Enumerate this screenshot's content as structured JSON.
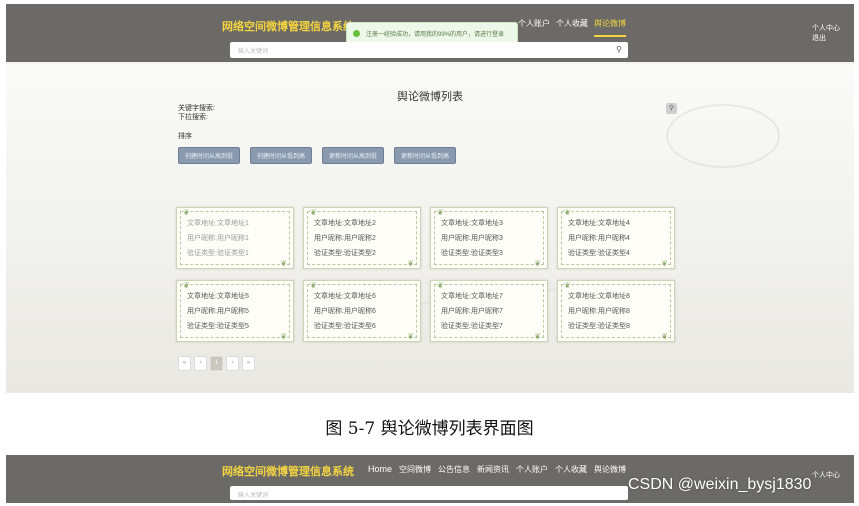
{
  "top_shot": {
    "brand": "网络空间微博管理信息系统",
    "toast": "注册一经验成功，请用我的99%的用户，请进行登录",
    "nav": [
      "个人账户",
      "个人收藏",
      "舆论微博"
    ],
    "user_menu": {
      "center": "个人中心",
      "logout": "退出"
    },
    "search_placeholder": "输入关键词",
    "page_title": "舆论微博列表",
    "filters": {
      "keyword_label": "关键字搜索:",
      "dropdown_label": "下拉搜索:"
    },
    "sort_label": "排序",
    "sort_buttons": [
      "创建时间从高到低",
      "创建时间从低到高",
      "更新时间从高到低",
      "更新时间从低到高"
    ],
    "cards": [
      {
        "a": "文章地址:文章地址1",
        "b": "用户昵称:用户昵称1",
        "c": "验证类型:验证类型1"
      },
      {
        "a": "文章地址:文章地址2",
        "b": "用户昵称:用户昵称2",
        "c": "验证类型:验证类型2"
      },
      {
        "a": "文章地址:文章地址3",
        "b": "用户昵称:用户昵称3",
        "c": "验证类型:验证类型3"
      },
      {
        "a": "文章地址:文章地址4",
        "b": "用户昵称:用户昵称4",
        "c": "验证类型:验证类型4"
      },
      {
        "a": "文章地址:文章地址5",
        "b": "用户昵称:用户昵称5",
        "c": "验证类型:验证类型5"
      },
      {
        "a": "文章地址:文章地址6",
        "b": "用户昵称:用户昵称6",
        "c": "验证类型:验证类型6"
      },
      {
        "a": "文章地址:文章地址7",
        "b": "用户昵称:用户昵称7",
        "c": "验证类型:验证类型7"
      },
      {
        "a": "文章地址:文章地址8",
        "b": "用户昵称:用户昵称8",
        "c": "验证类型:验证类型8"
      }
    ],
    "pager": [
      "«",
      "‹",
      "1",
      "›",
      "»"
    ]
  },
  "caption": "图 5-7 舆论微博列表界面图",
  "bottom_shot": {
    "brand": "网络空间微博管理信息系统",
    "nav": [
      "Home",
      "空间微博",
      "公告信息",
      "新闻资讯",
      "个人账户",
      "个人收藏",
      "舆论微博"
    ],
    "user_menu": "个人中心",
    "search_placeholder": "输入关键词"
  },
  "watermark": "CSDN @weixin_bysj1830",
  "colors": {
    "navbar": "#6b6a66",
    "accent": "#f2d341",
    "sort_button": "#8a9aae"
  }
}
